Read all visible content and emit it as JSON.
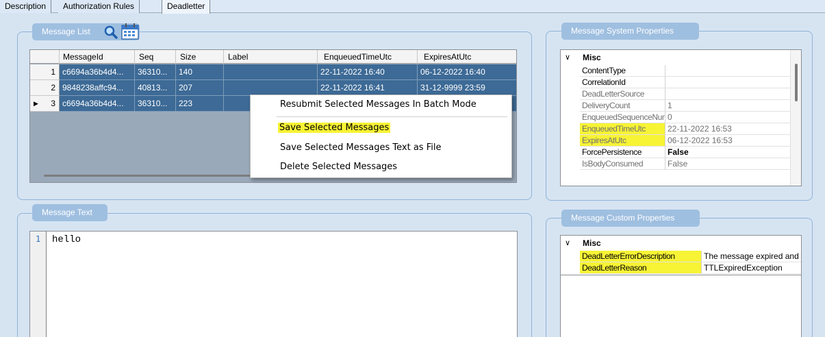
{
  "tabs": [
    "Description",
    "Authorization Rules",
    "Deadletter"
  ],
  "message_list": {
    "title": "Message List",
    "columns": [
      "MessageId",
      "Seq",
      "Size",
      "Label",
      "EnqueuedTimeUtc",
      "ExpiresAtUtc"
    ],
    "rows": [
      {
        "num": "1",
        "cells": [
          "c6694a36b4d4...",
          "36310...",
          "140",
          "",
          "22-11-2022 16:40",
          "06-12-2022 16:40"
        ]
      },
      {
        "num": "2",
        "cells": [
          "9848238affc94...",
          "40813...",
          "207",
          "",
          "22-11-2022 16:41",
          "31-12-9999 23:59"
        ]
      },
      {
        "num": "3",
        "cells": [
          "c6694a36b4d4...",
          "36310...",
          "223",
          "",
          "",
          ""
        ]
      }
    ]
  },
  "context_menu": [
    "Resubmit Selected Messages In Batch Mode",
    "Save Selected Messages",
    "Save Selected Messages Text as File",
    "Delete Selected Messages"
  ],
  "message_text": {
    "title": "Message Text",
    "line_number": "1",
    "content": "hello"
  },
  "system_properties": {
    "title": "Message System Properties",
    "category": "Misc",
    "rows": [
      {
        "name": "ContentType",
        "value": ""
      },
      {
        "name": "CorrelationId",
        "value": ""
      },
      {
        "name": "DeadLetterSource",
        "value": ""
      },
      {
        "name": "DeliveryCount",
        "value": "1"
      },
      {
        "name": "EnqueuedSequenceNumber",
        "value": "0"
      },
      {
        "name": "EnqueuedTimeUtc",
        "value": "22-11-2022 16:53"
      },
      {
        "name": "ExpiresAtUtc",
        "value": "06-12-2022 16:53"
      },
      {
        "name": "ForcePersistence",
        "value": "False"
      },
      {
        "name": "IsBodyConsumed",
        "value": "False"
      }
    ]
  },
  "custom_properties": {
    "title": "Message Custom Properties",
    "category": "Misc",
    "rows": [
      {
        "name": "DeadLetterErrorDescription",
        "value": "The message expired and was dead lettered."
      },
      {
        "name": "DeadLetterReason",
        "value": "TTLExpiredException"
      }
    ]
  },
  "colors": {
    "highlight": "#f7f335",
    "selected_row": "#3d6a96",
    "group_title": "#9fbfe0",
    "background": "#d6e4f2"
  }
}
